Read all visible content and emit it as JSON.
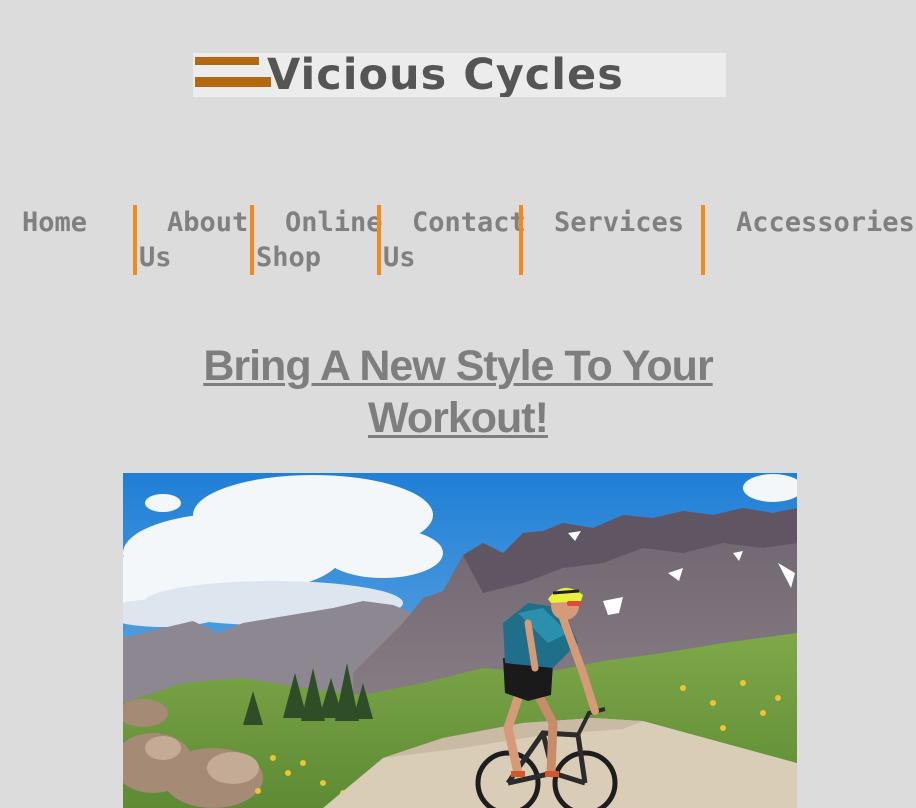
{
  "logo": {
    "text": "Vicious Cycles"
  },
  "nav": {
    "items": [
      {
        "label": "Home"
      },
      {
        "label": "About Us"
      },
      {
        "label": "Online Shop"
      },
      {
        "label": "Contact Us"
      },
      {
        "label": "Services"
      },
      {
        "label": "Accessories"
      }
    ]
  },
  "main": {
    "headline_line1": "Bring A New Style To Your",
    "headline_line2": "Workout!"
  },
  "colors": {
    "background": "#dcdcdc",
    "nav_separator": "#f28a1a",
    "logo_accent": "#b4680f",
    "text": "#808080"
  }
}
